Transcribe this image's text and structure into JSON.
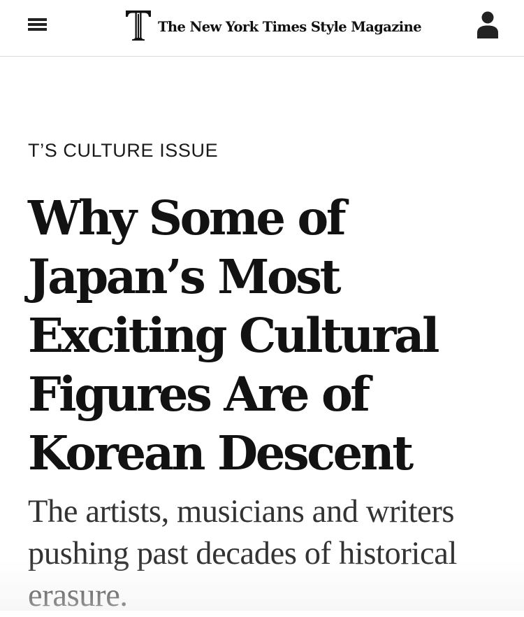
{
  "header": {
    "menu_icon": "hamburger-menu-icon",
    "logo_mark": "T",
    "logo_text": "The New York Times Style Magazine",
    "account_icon": "user-account-icon"
  },
  "article": {
    "kicker": "T’S CULTURE ISSUE",
    "headline": "Why Some of Japan’s Most Exciting Cultural Figures Are of Korean Descent",
    "summary": "The artists, musicians and writers pushing past decades of historical erasure."
  },
  "colors": {
    "text": "#121212",
    "summary_text": "#333333",
    "divider": "#dcdcdc",
    "background": "#ffffff"
  }
}
